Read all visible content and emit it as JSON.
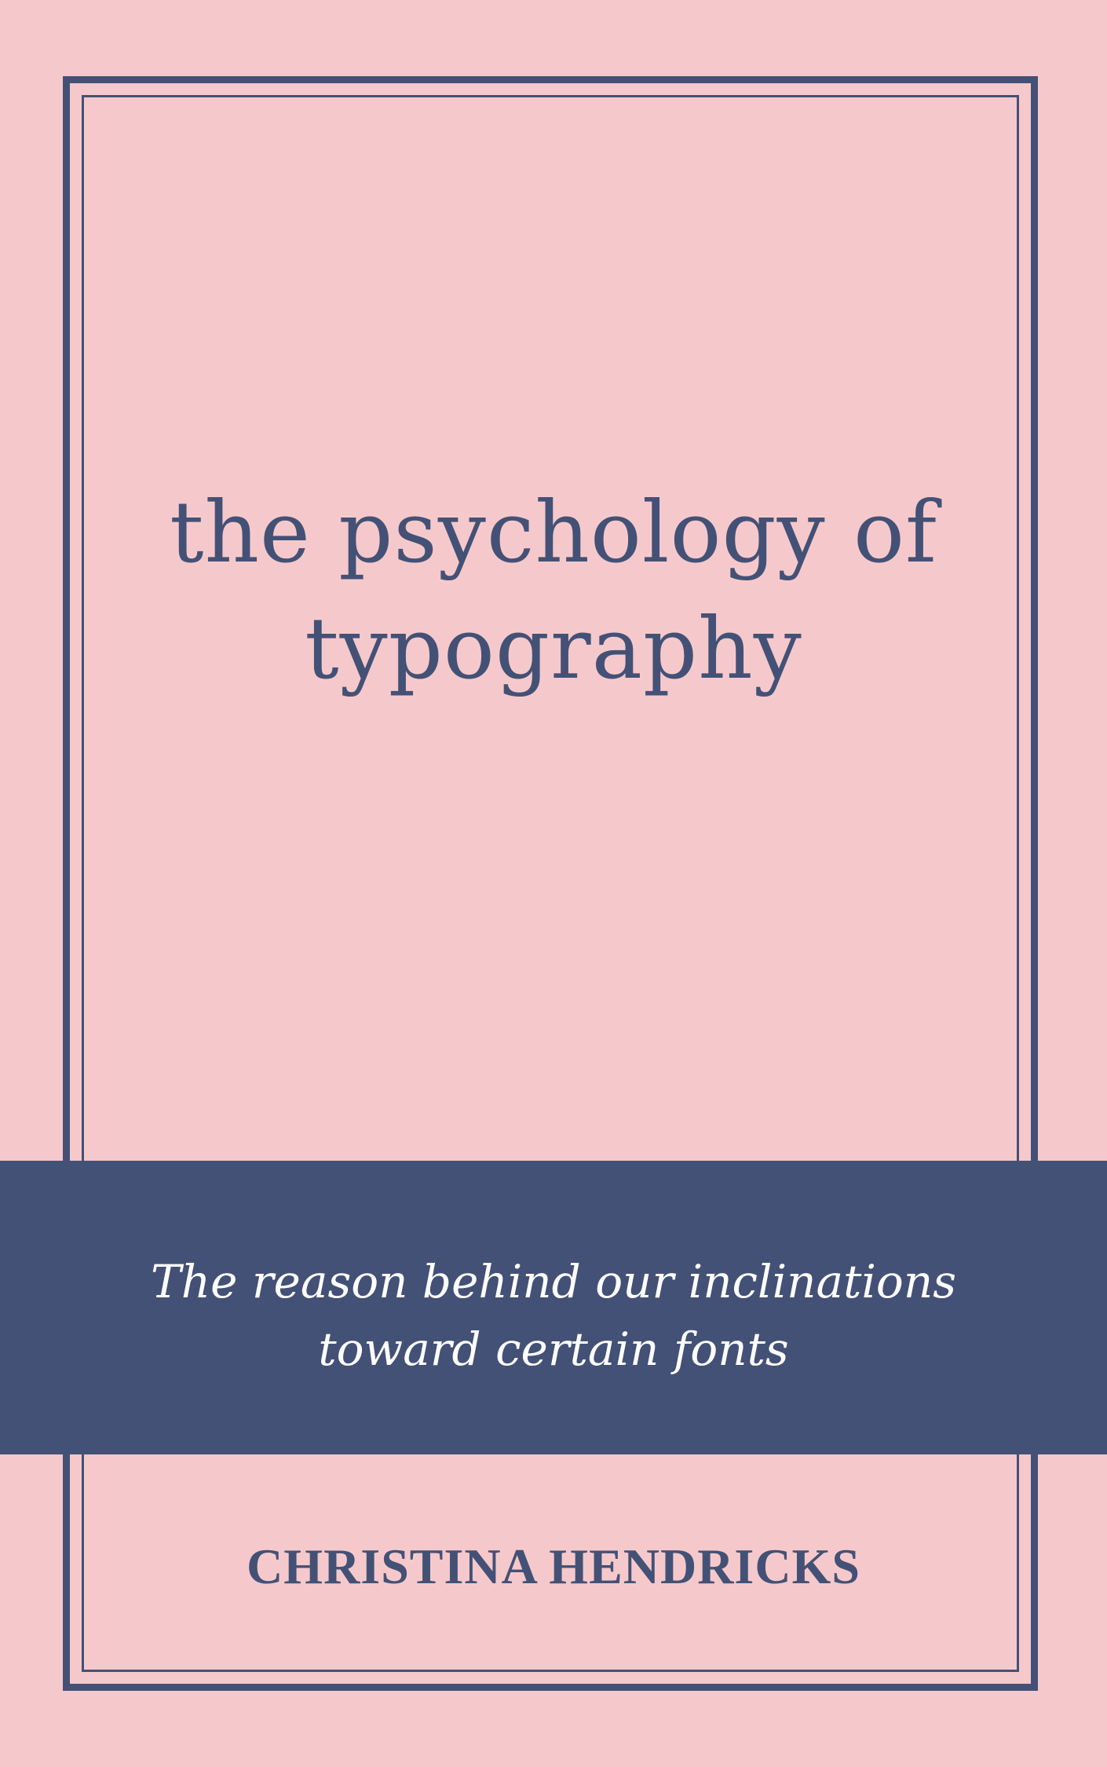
{
  "cover": {
    "title_line1": "the psychology of",
    "title_line2": "typography",
    "subtitle_line1": "The reason behind our inclinations",
    "subtitle_line2": "toward certain fonts",
    "author": "CHRISTINA HENDRICKS"
  },
  "colors": {
    "background": "#f5c9cb",
    "accent": "#445176",
    "subtitle_text": "#ffffff"
  }
}
